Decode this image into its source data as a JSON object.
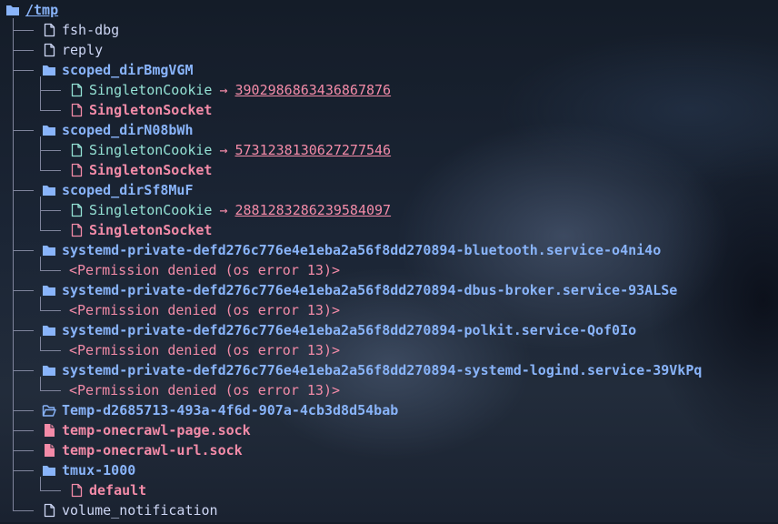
{
  "root": {
    "label": "/tmp"
  },
  "colors": {
    "directory": "#89b4fa",
    "file": "#cdd6f4",
    "symlink": "#94e2d5",
    "socket": "#f38ba8",
    "error": "#f38ba8",
    "tree_lines": "#7f849c"
  },
  "entries": [
    {
      "name": "fsh-dbg",
      "type": "file",
      "icon": "file-icon"
    },
    {
      "name": "reply",
      "type": "file",
      "icon": "file-icon"
    },
    {
      "name": "scoped_dirBmgVGM",
      "type": "dir",
      "icon": "folder-icon",
      "children": [
        {
          "name": "SingletonCookie",
          "type": "symlink",
          "icon": "file-icon",
          "arrow": "→",
          "target": "3902986863436867876"
        },
        {
          "name": "SingletonSocket",
          "type": "socket",
          "icon": "file-icon"
        }
      ]
    },
    {
      "name": "scoped_dirN08bWh",
      "type": "dir",
      "icon": "folder-icon",
      "children": [
        {
          "name": "SingletonCookie",
          "type": "symlink",
          "icon": "file-icon",
          "arrow": "→",
          "target": "5731238130627277546"
        },
        {
          "name": "SingletonSocket",
          "type": "socket",
          "icon": "file-icon"
        }
      ]
    },
    {
      "name": "scoped_dirSf8MuF",
      "type": "dir",
      "icon": "folder-icon",
      "children": [
        {
          "name": "SingletonCookie",
          "type": "symlink",
          "icon": "file-icon",
          "arrow": "→",
          "target": "2881283286239584097"
        },
        {
          "name": "SingletonSocket",
          "type": "socket",
          "icon": "file-icon"
        }
      ]
    },
    {
      "name": "systemd-private-defd276c776e4e1eba2a56f8dd270894-bluetooth.service-o4ni4o",
      "type": "dir",
      "icon": "folder-icon",
      "children": [
        {
          "name": "<Permission denied (os error 13)>",
          "type": "error"
        }
      ]
    },
    {
      "name": "systemd-private-defd276c776e4e1eba2a56f8dd270894-dbus-broker.service-93ALSe",
      "type": "dir",
      "icon": "folder-icon",
      "children": [
        {
          "name": "<Permission denied (os error 13)>",
          "type": "error"
        }
      ]
    },
    {
      "name": "systemd-private-defd276c776e4e1eba2a56f8dd270894-polkit.service-Qof0Io",
      "type": "dir",
      "icon": "folder-icon",
      "children": [
        {
          "name": "<Permission denied (os error 13)>",
          "type": "error"
        }
      ]
    },
    {
      "name": "systemd-private-defd276c776e4e1eba2a56f8dd270894-systemd-logind.service-39VkPq",
      "type": "dir",
      "icon": "folder-icon",
      "children": [
        {
          "name": "<Permission denied (os error 13)>",
          "type": "error"
        }
      ]
    },
    {
      "name": "Temp-d2685713-493a-4f6d-907a-4cb3d8d54bab",
      "type": "dir-open",
      "icon": "folder-open-icon",
      "children": []
    },
    {
      "name": "temp-onecrawl-page.sock",
      "type": "socket",
      "icon": "file-filled-icon"
    },
    {
      "name": "temp-onecrawl-url.sock",
      "type": "socket",
      "icon": "file-filled-icon"
    },
    {
      "name": "tmux-1000",
      "type": "dir",
      "icon": "folder-icon",
      "children": [
        {
          "name": "default",
          "type": "socket",
          "icon": "file-icon"
        }
      ]
    },
    {
      "name": "volume_notification",
      "type": "file",
      "icon": "file-icon"
    }
  ]
}
